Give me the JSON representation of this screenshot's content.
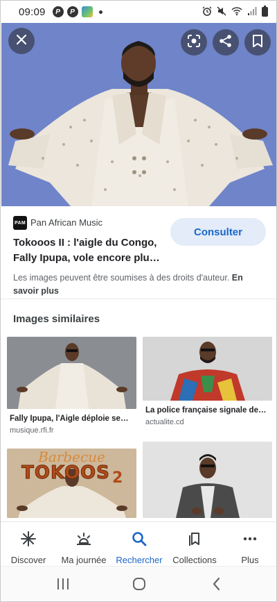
{
  "status_bar": {
    "time": "09:09",
    "app_icons": [
      "P",
      "P"
    ]
  },
  "hero": {
    "close_icon": "close-icon",
    "lens_icon": "lens-icon",
    "share_icon": "share-icon",
    "bookmark_icon": "bookmark-icon"
  },
  "source": {
    "logo_text": "PAM",
    "name": "Pan African Music",
    "title": "Tokooos II : l'aigle du Congo, Fally Ipupa, vole encore plu…",
    "consult_label": "Consulter",
    "copyright_text": "Les images peuvent être soumises à des droits d'auteur.",
    "learn_more": "En savoir plus"
  },
  "similar": {
    "heading": "Images similaires",
    "items": [
      {
        "caption": "Fally Ipupa, l'Aigle déploie se…",
        "domain": "musique.rfi.fr"
      },
      {
        "caption": "La police française signale de…",
        "domain": "actualite.cd"
      },
      {
        "overlay_line1": "Barbecue",
        "overlay_line2": "TOKOOS",
        "overlay_num": "2"
      },
      {}
    ]
  },
  "bottom_nav": {
    "items": [
      {
        "label": "Discover",
        "icon": "asterisk-icon"
      },
      {
        "label": "Ma journée",
        "icon": "sunrise-icon"
      },
      {
        "label": "Rechercher",
        "icon": "search-icon"
      },
      {
        "label": "Collections",
        "icon": "collections-icon"
      },
      {
        "label": "Plus",
        "icon": "more-icon"
      }
    ],
    "active_index": 2
  },
  "colors": {
    "accent": "#1a66c9",
    "hero_bg": "#6f84c9",
    "consult_bg": "#e3ecf8"
  }
}
